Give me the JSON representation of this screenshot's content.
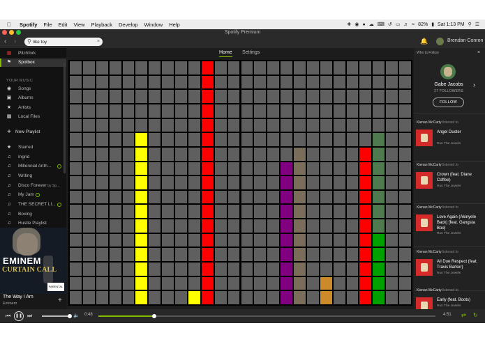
{
  "menubar": {
    "items": [
      "Spotify",
      "File",
      "Edit",
      "View",
      "Playback",
      "Develop",
      "Window",
      "Help"
    ],
    "battery": "82%",
    "clock": "Sat 1:13 PM"
  },
  "window": {
    "title": "Spotify Premium"
  },
  "search": {
    "value": "like toy"
  },
  "user": {
    "name": "Brendan Conron"
  },
  "sidebar": {
    "top_items": [
      {
        "label": "Pitchfork",
        "icon": "pitchfork-app-icon"
      },
      {
        "label": "Spotbox",
        "icon": "spotbox-app-icon"
      }
    ],
    "music_header": "YOUR MUSIC",
    "music_items": [
      {
        "label": "Songs",
        "icon": "songs-icon"
      },
      {
        "label": "Albums",
        "icon": "album-icon"
      },
      {
        "label": "Artists",
        "icon": "artist-icon"
      },
      {
        "label": "Local Files",
        "icon": "local-files-icon"
      }
    ],
    "new_playlist": "New Playlist",
    "playlists": [
      {
        "label": "Starred",
        "icon": "star-icon",
        "by": ""
      },
      {
        "label": "Ingrid",
        "icon": "note-icon",
        "by": ""
      },
      {
        "label": "Millennial Anth...",
        "icon": "note-icon",
        "by": ""
      },
      {
        "label": "Writing",
        "icon": "note-icon",
        "by": ""
      },
      {
        "label": "Disco Forever",
        "icon": "note-icon",
        "by": "by Sp..."
      },
      {
        "label": "My Jam",
        "icon": "note-icon",
        "by": ""
      },
      {
        "label": "THE SECRET LI...",
        "icon": "note-icon",
        "by": ""
      },
      {
        "label": "Boxing",
        "icon": "note-icon",
        "by": ""
      },
      {
        "label": "Hustle Playlist",
        "icon": "note-icon",
        "by": ""
      }
    ]
  },
  "album_art": {
    "artist": "EMINEM",
    "album": "CURTAIN CALL",
    "badge": "PARENTAL ADVISORY"
  },
  "now_playing": {
    "track": "The Way I Am",
    "artist": "Eminem"
  },
  "tabs": [
    "Home",
    "Settings"
  ],
  "sequencer": {
    "rows": 17,
    "cols": 26,
    "off_color": "#5f5f5f",
    "columns": [
      {
        "col": 5,
        "color": "#ffff00",
        "from_row": 5
      },
      {
        "col": 10,
        "color": "#ff0000",
        "from_row": 0
      },
      {
        "col": 16,
        "color": "#800080",
        "from_row": 7
      },
      {
        "col": 17,
        "color": "#7a6e5a",
        "from_row": 6
      },
      {
        "col": 22,
        "color": "#ff0000",
        "from_row": 6
      },
      {
        "col": 23,
        "color": "#4f7a4f",
        "from_row": 5
      }
    ],
    "extra_cells": [
      {
        "col": 9,
        "row": 16,
        "color": "#ffff00"
      },
      {
        "col": 19,
        "row": 15,
        "color": "#cc8a2a"
      },
      {
        "col": 19,
        "row": 16,
        "color": "#cc8a2a"
      },
      {
        "col": 23,
        "row": 12,
        "color": "#00a000"
      },
      {
        "col": 23,
        "row": 13,
        "color": "#00a000"
      },
      {
        "col": 23,
        "row": 14,
        "color": "#00a000"
      },
      {
        "col": 23,
        "row": 15,
        "color": "#00a000"
      },
      {
        "col": 23,
        "row": 16,
        "color": "#00a000"
      }
    ]
  },
  "right_panel": {
    "header": "Who to Follow",
    "follow_name": "Gabe Jacobs",
    "follow_count": "27 FOLLOWERS",
    "follow_button": "FOLLOW",
    "listened": "listened to",
    "feed": [
      {
        "user": "Kienan McCarty",
        "song": "Angel Duster",
        "band": "Run The Jewels"
      },
      {
        "user": "Kienan McCarty",
        "song": "Crown (feat. Diane Coffee)",
        "band": "Run The Jewels"
      },
      {
        "user": "Kienan McCarty",
        "song": "Love Again (Akinyele Back) [feat. Gangsta Boo]",
        "band": "Run The Jewels"
      },
      {
        "user": "Kienan McCarty",
        "song": "All Due Respect (feat. Travis Barker)",
        "band": "Run The Jewels"
      },
      {
        "user": "Kienan McCarty",
        "song": "Early (feat. Boots)",
        "band": "Run The Jewels"
      }
    ]
  },
  "player": {
    "current_time": "0:48",
    "total_time": "4:51",
    "progress": 0.165,
    "volume": 0.95,
    "accent": "#84bd00"
  }
}
